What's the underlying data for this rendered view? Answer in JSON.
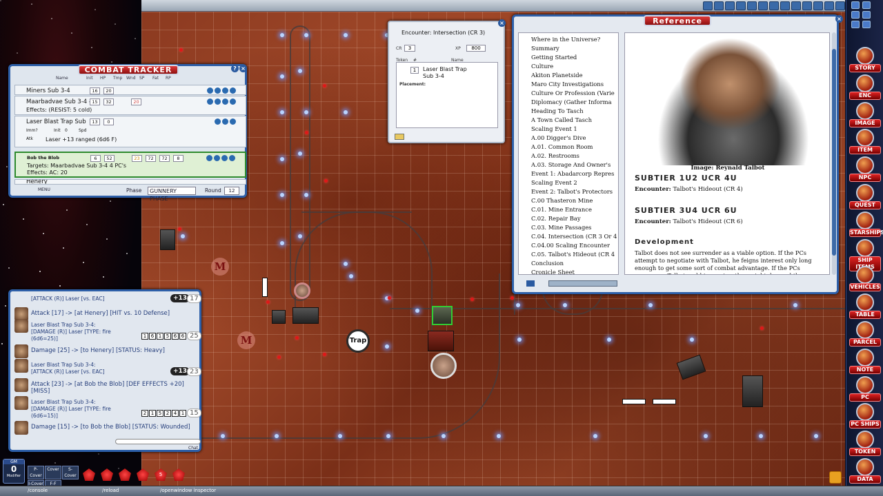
{
  "combat_tracker": {
    "title": "COMBAT TRACKER",
    "columns": [
      "Name",
      "Init",
      "HP",
      "Tmp",
      "Wnd",
      "SP",
      "Fat",
      "RP"
    ],
    "rows": [
      {
        "name": "Miners Sub 3-4",
        "init": "16",
        "hp": "20",
        "sub": ""
      },
      {
        "name": "Maarbadvae Sub 3-4 -",
        "init": "15",
        "hp": "32",
        "wnd": "20",
        "sub": "Effects: (RESIST: 5 cold)"
      },
      {
        "name": "Laser Blast Trap Sub",
        "init": "13",
        "hp": "0",
        "sub": "Laser +13 ranged (6d6 F)"
      },
      {
        "name": "Bob the Blob",
        "init": "6",
        "hp": "52",
        "wnd": "23",
        "sp": "72",
        "fat": "72",
        "rp": "8",
        "sub": "Targets: Maarbadvae Sub 3-4 4 PC's",
        "sub2": "Effects: AC: 20"
      },
      {
        "name": "Henery",
        "sub": ""
      }
    ],
    "imm_label": "Imm?",
    "init_label": "Init",
    "init_value": "0",
    "spd_label": "Spd",
    "atk_label": "Atk",
    "phase_label": "Phase",
    "phase_value": "GUNNERY PHASE",
    "round_label": "Round",
    "round_value": "12",
    "menu": "MENU"
  },
  "chat": {
    "lines": [
      {
        "text": "[ATTACK (R)] Laser [vs. EAC]",
        "mod": "+13",
        "total": "17"
      },
      {
        "text": "Attack [17] -> [at Henery] [HIT vs. 10 Defense]"
      },
      {
        "text": "Laser Blast Trap Sub 3-4:"
      },
      {
        "text": "[DAMAGE (R)] Laser [TYPE: fire",
        "dice": [
          "1",
          "6",
          "1",
          "5",
          "6",
          "6"
        ],
        "total": "25"
      },
      {
        "text": "(6d6=25)]"
      },
      {
        "text": "Damage [25] -> [to Henery] [STATUS: Heavy]"
      },
      {
        "text": "Laser Blast Trap Sub 3-4:"
      },
      {
        "text": "[ATTACK (R)] Laser [vs. EAC]",
        "mod": "+13",
        "total": "23"
      },
      {
        "text": "Attack [23] -> [at Bob the Blob] [DEF EFFECTS +20]"
      },
      {
        "text": "[MISS]"
      },
      {
        "text": "Laser Blast Trap Sub 3-4:"
      },
      {
        "text": "[DAMAGE (R)] Laser [TYPE: fire",
        "dice": [
          "2",
          "1",
          "5",
          "2",
          "4",
          "1"
        ],
        "total": "15"
      },
      {
        "text": "(6d6=15)]"
      },
      {
        "text": "Damage [15] -> [to Bob the Blob] [STATUS: Wounded]"
      }
    ],
    "chat_label": "Chat"
  },
  "encounter": {
    "title": "Encounter: Intersection (CR 3)",
    "cr_label": "CR",
    "cr_value": "3",
    "xp_label": "XP",
    "xp_value": "800",
    "token_label": "Token",
    "num_label": "#",
    "name_label": "Name",
    "entry_count": "1",
    "entry_name_1": "Laser Blast Trap",
    "entry_name_2": "Sub 3-4",
    "placement_label": "Placement:"
  },
  "reference": {
    "title": "Reference",
    "toc": [
      "Where in the Universe?",
      "Summary",
      "Getting Started",
      "Culture",
      "Akiton Planetside",
      "Maro City Investigations",
      "Culture Or Profession (Varie",
      "Diplomacy (Gather Informa",
      "Heading To Tasch",
      "A Town Called Tasch",
      "Scaling Event 1",
      "A.00 Digger's Dive",
      "A.01. Common Room",
      "A.02. Restrooms",
      "A.03. Storage And Owner's",
      "Event 1: Abadarcorp Repres",
      "Scaling Event 2",
      "Event 2: Talbot's Protectors",
      "C.00 Thasteron Mine",
      "C.01. Mine Entrance",
      "C.02. Repair Bay",
      "C.03. Mine Passages",
      "C.04. Intersection (CR 3 Or 4",
      "C.04.00 Scaling Encounter",
      "C.05. Talbot's Hideout (CR 4",
      "Conclusion",
      "Cronicle Sheet"
    ],
    "image_caption": "Image: Reynald Talbot",
    "heading1": "SUBTIER 1U2 UCR 4U",
    "link1_label": "Encounter:",
    "link1_text": "Talbot's Hideout (CR 4)",
    "heading2": "SUBTIER 3U4 UCR 6U",
    "link2_label": "Encounter:",
    "link2_text": "Talbot's Hideout (CR 6)",
    "dev_heading": "Development",
    "paragraph": "Talbot does not see surrender as a viable option. If the PCs attempt to negotiate with Talbot, he feigns interest only long enough to get some sort of combat advantage. If the PCs overpower Talbot and his cronies, they might demand the charlatan's stone in exchange for letting Talbot escape, or least"
  },
  "map": {
    "trap_label": "Trap",
    "marker_label": "M"
  },
  "sidebar": {
    "buttons": [
      "STORY",
      "ENC",
      "IMAGE",
      "ITEM",
      "NPC",
      "QUEST",
      "STARSHIPS",
      "SHIP ITEMS",
      "VEHICLES",
      "TABLE",
      "PARCEL",
      "NOTE",
      "PC",
      "PC SHIPS",
      "TOKEN",
      "DATA"
    ]
  },
  "bottom": {
    "gm_label": "GM",
    "gm_value": "0",
    "gm_sub": "Modifier",
    "mods": [
      "P-Cover",
      "Cover",
      "S-Cover",
      "I-Cover",
      "F-F"
    ],
    "dice": [
      "",
      "",
      "",
      "",
      "5",
      ""
    ],
    "cmd1": "/console",
    "cmd2": "/reload",
    "cmd3": "/openwindow inspector"
  },
  "colors": {
    "panel_border": "#2d5fa8",
    "title_red": "#c82020",
    "chat_text": "#233c7a",
    "map_red": "#9a4526"
  }
}
